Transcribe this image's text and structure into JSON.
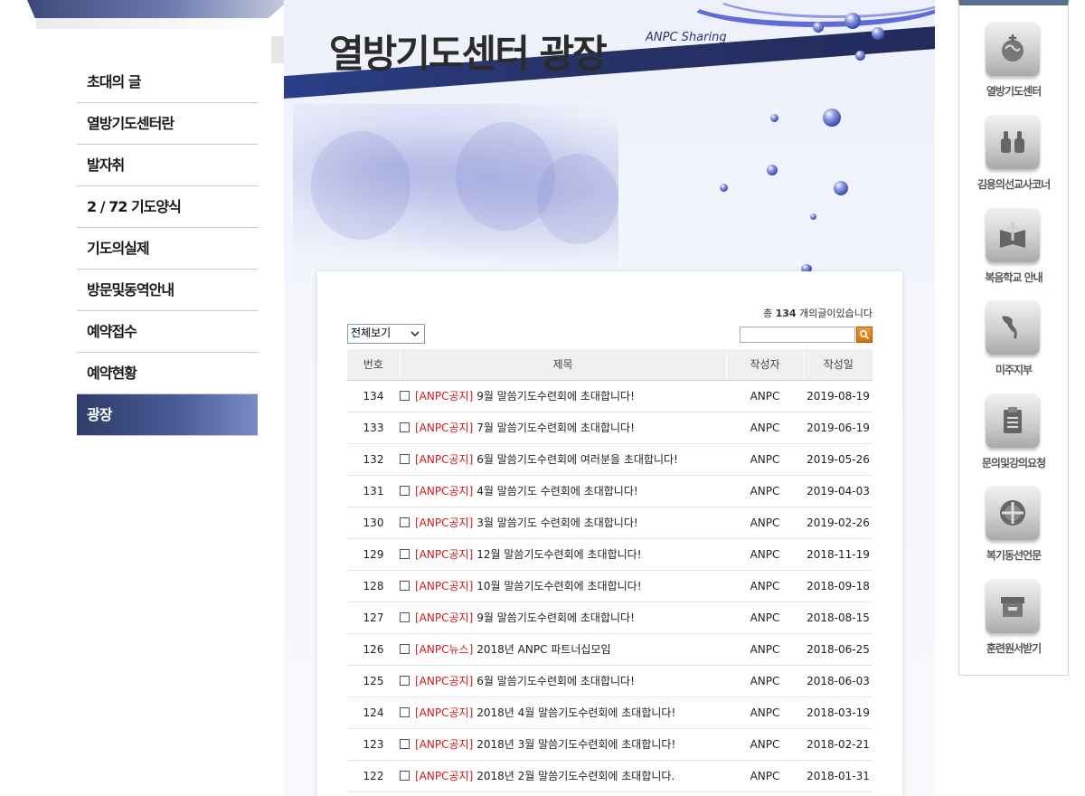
{
  "left_menu": {
    "items": [
      {
        "label": "초대의 글",
        "active": false
      },
      {
        "label": "열방기도센터란",
        "active": false
      },
      {
        "label": "발자취",
        "active": false
      },
      {
        "label": "2 / 72 기도양식",
        "active": false
      },
      {
        "label": "기도의실제",
        "active": false
      },
      {
        "label": "방문및동역안내",
        "active": false
      },
      {
        "label": "예약접수",
        "active": false
      },
      {
        "label": "예약현황",
        "active": false
      },
      {
        "label": "광장",
        "active": true
      }
    ]
  },
  "banner": {
    "title": "열방기도센터 광장",
    "subtitle": "ANPC Sharing"
  },
  "board": {
    "total_prefix": "총",
    "total_count": "134",
    "total_suffix": "개의글이있습니다",
    "filter": {
      "selected": "전체보기"
    },
    "search": {
      "value": ""
    },
    "columns": {
      "num": "번호",
      "title": "제목",
      "writer": "작성자",
      "date": "작성일"
    },
    "rows": [
      {
        "num": "134",
        "tag": "[ANPC공지]",
        "title": "9월 말씀기도수련회에 초대합니다!",
        "writer": "ANPC",
        "date": "2019-08-19"
      },
      {
        "num": "133",
        "tag": "[ANPC공지]",
        "title": "7월 말씀기도수련회에 초대합니다!",
        "writer": "ANPC",
        "date": "2019-06-19"
      },
      {
        "num": "132",
        "tag": "[ANPC공지]",
        "title": "6월 말씀기도수련회에 여러분을 초대합니다!",
        "writer": "ANPC",
        "date": "2019-05-26"
      },
      {
        "num": "131",
        "tag": "[ANPC공지]",
        "title": "4월 말씀기도 수련회에 초대합니다!",
        "writer": "ANPC",
        "date": "2019-04-03"
      },
      {
        "num": "130",
        "tag": "[ANPC공지]",
        "title": "3월 말씀기도 수련회에 초대합니다!",
        "writer": "ANPC",
        "date": "2019-02-26"
      },
      {
        "num": "129",
        "tag": "[ANPC공지]",
        "title": "12월 말씀기도수련회에 초대합니다!",
        "writer": "ANPC",
        "date": "2018-11-19"
      },
      {
        "num": "128",
        "tag": "[ANPC공지]",
        "title": "10월 말씀기도수련회에 초대합니다!",
        "writer": "ANPC",
        "date": "2018-09-18"
      },
      {
        "num": "127",
        "tag": "[ANPC공지]",
        "title": "9월 말씀기도수련회에 초대합니다!",
        "writer": "ANPC",
        "date": "2018-08-15"
      },
      {
        "num": "126",
        "tag": "[ANPC뉴스]",
        "title": "2018년 ANPC 파트너십모임",
        "writer": "ANPC",
        "date": "2018-06-25"
      },
      {
        "num": "125",
        "tag": "[ANPC공지]",
        "title": "6월 말씀기도수련회에 초대합니다!",
        "writer": "ANPC",
        "date": "2018-06-03"
      },
      {
        "num": "124",
        "tag": "[ANPC공지]",
        "title": "2018년 4월 말씀기도수련회에 초대합니다!",
        "writer": "ANPC",
        "date": "2018-03-19"
      },
      {
        "num": "123",
        "tag": "[ANPC공지]",
        "title": "2018년 3월 말씀기도수련회에 초대합니다!",
        "writer": "ANPC",
        "date": "2018-02-21"
      },
      {
        "num": "122",
        "tag": "[ANPC공지]",
        "title": "2018년 2월 말씀기도수련회에 초대합니다.",
        "writer": "ANPC",
        "date": "2018-01-31"
      }
    ]
  },
  "quick_menu": {
    "items": [
      {
        "label": "열방기도센터",
        "icon": "globe-cross-icon"
      },
      {
        "label": "김용의선교사코너",
        "icon": "thumbs-up-icon"
      },
      {
        "label": "복음학교 안내",
        "icon": "cross-book-icon"
      },
      {
        "label": "미주지부",
        "icon": "americas-map-icon"
      },
      {
        "label": "문의및강의요청",
        "icon": "clipboard-icon"
      },
      {
        "label": "복기동선언문",
        "icon": "cross-circle-icon"
      },
      {
        "label": "훈련원서받기",
        "icon": "archive-box-icon"
      }
    ]
  },
  "colors": {
    "accent_navy": "#2f3c68",
    "tag_red": "#d11a1a",
    "search_orange": "#e8820f",
    "header_grey": "#efefef"
  }
}
